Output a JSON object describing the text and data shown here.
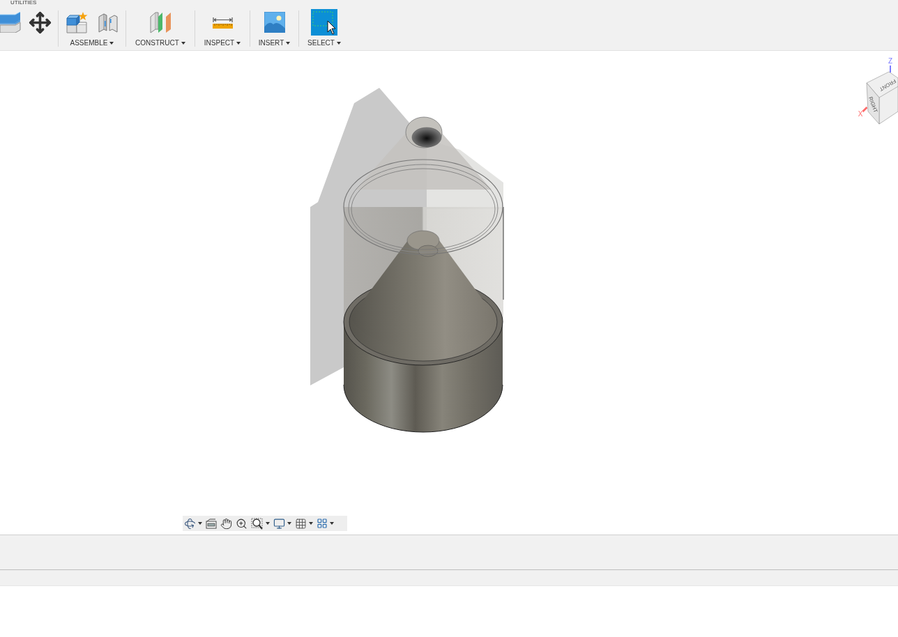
{
  "ribbon": {
    "tab": "UTILITIES",
    "groups": [
      {
        "kind": "assemble",
        "label": "ASSEMBLE"
      },
      {
        "kind": "construct",
        "label": "CONSTRUCT"
      },
      {
        "kind": "inspect",
        "label": "INSPECT"
      },
      {
        "kind": "insert",
        "label": "INSERT"
      },
      {
        "kind": "select",
        "label": "SELECT"
      }
    ]
  },
  "view_cube": {
    "top_face": "FRONT",
    "side_face": "RIGHT",
    "axes": [
      {
        "kind": "z",
        "label": "Z",
        "color": "#7b7bff"
      },
      {
        "kind": "x",
        "label": "X",
        "color": "#ff7070"
      }
    ]
  }
}
